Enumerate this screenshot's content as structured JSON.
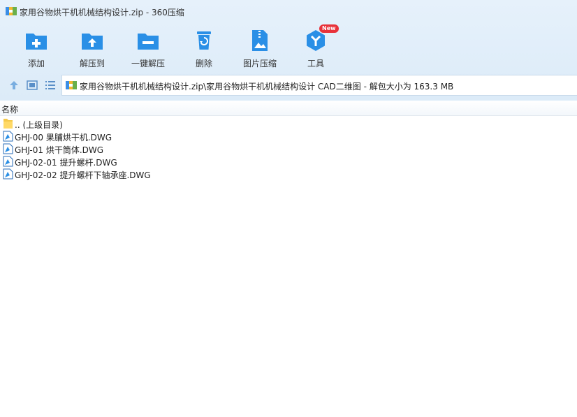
{
  "window": {
    "title": "家用谷物烘干机机械结构设计.zip - 360压缩"
  },
  "toolbar": {
    "items": [
      {
        "label": "添加",
        "icon": "add-file-icon"
      },
      {
        "label": "解压到",
        "icon": "extract-to-icon"
      },
      {
        "label": "一键解压",
        "icon": "one-click-extract-icon"
      },
      {
        "label": "删除",
        "icon": "delete-icon"
      },
      {
        "label": "图片压缩",
        "icon": "image-compress-icon"
      },
      {
        "label": "工具",
        "icon": "tools-icon",
        "badge": "New"
      }
    ]
  },
  "address": {
    "path": "家用谷物烘干机机械结构设计.zip\\家用谷物烘干机机械结构设计 CAD二维图 - 解包大小为 163.3 MB"
  },
  "list": {
    "column_name": "名称",
    "rows": [
      {
        "name": ".. (上级目录)",
        "type": "folder-up"
      },
      {
        "name": "GHJ-00 果脯烘干机.DWG",
        "type": "dwg"
      },
      {
        "name": "GHJ-01 烘干筒体.DWG",
        "type": "dwg"
      },
      {
        "name": "GHJ-02-01 提升螺杆.DWG",
        "type": "dwg"
      },
      {
        "name": "GHJ-02-02 提升螺杆下轴承座.DWG",
        "type": "dwg"
      }
    ]
  },
  "colors": {
    "accent": "#2a8fe6",
    "toolbar_bg": "#e2eefa",
    "badge": "#e8323a",
    "folder": "#f5c94a"
  }
}
